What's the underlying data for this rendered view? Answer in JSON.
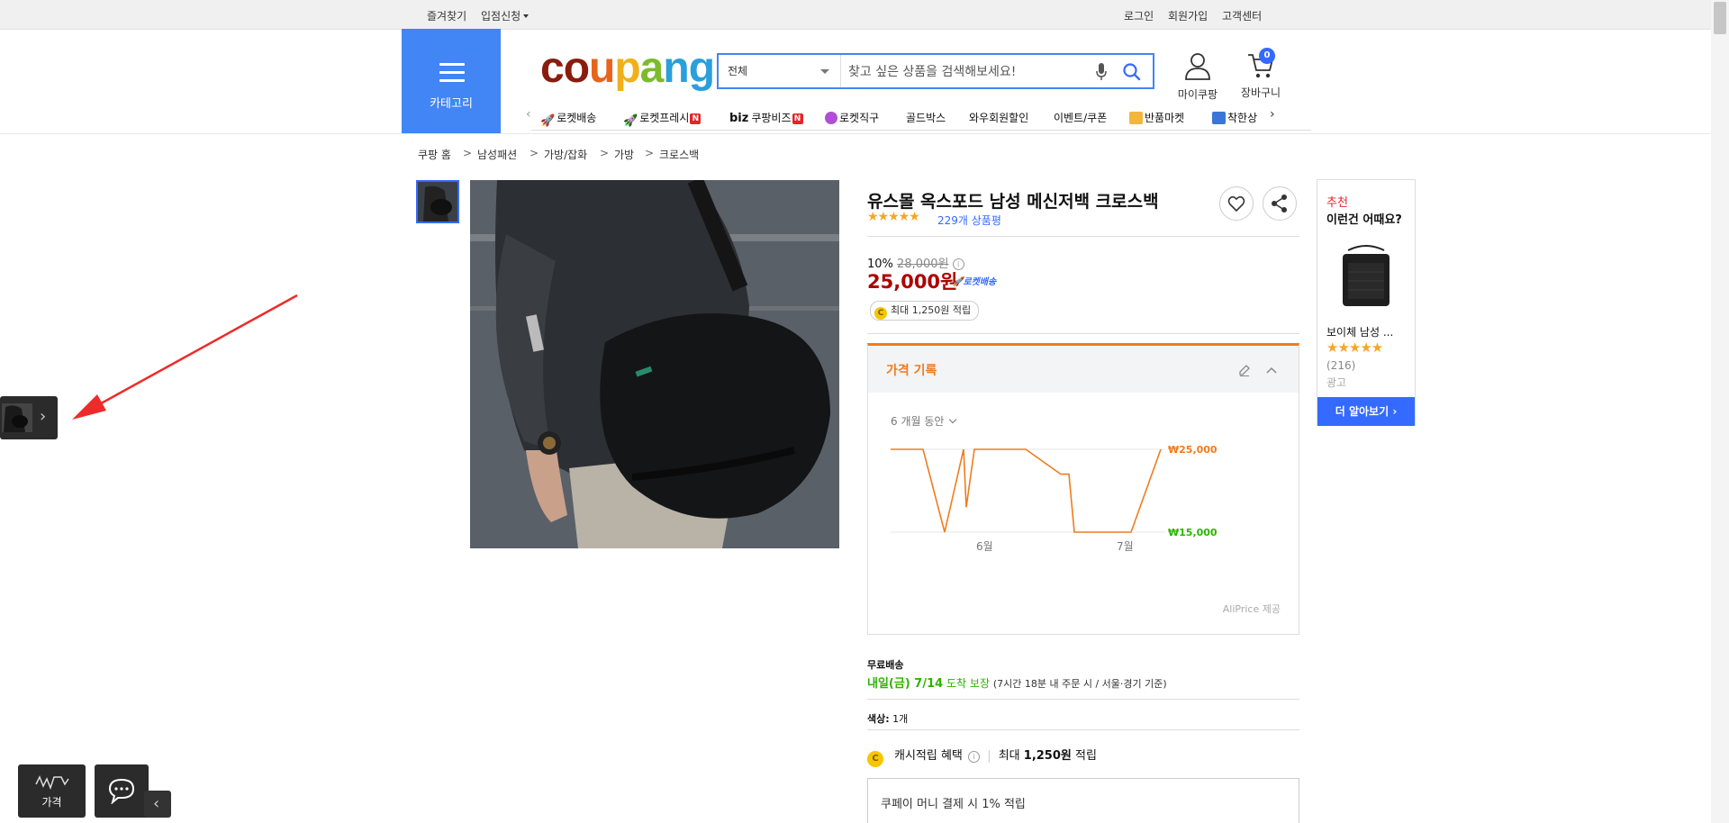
{
  "topbar": {
    "favorites": "즐겨찾기",
    "seller_apply": "입점신청",
    "login": "로그인",
    "signup": "회원가입",
    "customer_center": "고객센터"
  },
  "header": {
    "category_label": "카테고리",
    "logo_parts": [
      "co",
      "u",
      "p",
      "a",
      "ng"
    ],
    "search": {
      "scope": "전체",
      "placeholder": "찾고 싶은 상품을 검색해보세요!"
    },
    "mypage_label": "마이쿠팡",
    "cart_label": "장바구니",
    "cart_count": "0"
  },
  "nav": {
    "items": [
      "로켓배송",
      "로켓프레시",
      "쿠팡비즈",
      "로켓직구",
      "골드박스",
      "와우회원할인",
      "이벤트/쿠폰",
      "반품마켓",
      "착한상"
    ],
    "biz_prefix": "biz",
    "new_badge": "N"
  },
  "breadcrumb": {
    "items": [
      "쿠팡 홈",
      "남성패션",
      "가방/잡화",
      "가방",
      "크로스백"
    ],
    "separator": ">"
  },
  "product": {
    "title": "유스몰 옥스포드 남성 메신저백 크로스백",
    "rating": 4.5,
    "stars": "★★★★★",
    "review_count": "229개 상품평",
    "discount": "10%",
    "original_price": "28,000원",
    "info_glyph": "i",
    "price": "25,000원",
    "rocket": "로켓배송",
    "points_coin": "C",
    "points": "최대 1,250원 적립"
  },
  "price_history": {
    "title": "가격 기록",
    "period": "6 개월 동안",
    "source": "AliPrice 제공",
    "chart_data": {
      "type": "line",
      "y_ticks": [
        "₩25,000",
        "₩15,000"
      ],
      "x_ticks": [
        "6월",
        "7월"
      ],
      "ylim": [
        15000,
        25000
      ],
      "series": [
        {
          "color": "#f07c1e",
          "x": [
            0,
            0.12,
            0.2,
            0.27,
            0.28,
            0.31,
            0.33,
            0.35,
            0.5,
            0.63,
            0.66,
            0.68,
            0.89,
            1.0
          ],
          "values": [
            25000,
            25000,
            15000,
            25000,
            18000,
            25000,
            25000,
            25000,
            25000,
            22000,
            22000,
            15000,
            15000,
            25000
          ]
        }
      ],
      "colors": {
        "max_label": "#f07c1e",
        "min_label": "#2db400"
      }
    }
  },
  "delivery": {
    "free_shipping": "무료배송",
    "arrival": "내일(금) 7/14",
    "guarantee": "도착 보장",
    "condition": "(7시간 18분  내 주문 시 / 서울·경기 기준)",
    "color_label": "색상:",
    "color_value": "1개",
    "cash_benefit": "캐시적립 혜택",
    "cash_max_prefix": "최대",
    "cash_max_amount": "1,250원",
    "cash_max_suffix": "적립",
    "coupay": "쿠페이 머니 결제 시 1% 적립"
  },
  "recommend": {
    "label": "추천",
    "question": "이런건 어때요?",
    "item_name": "보이체 남성 ...",
    "item_stars": "★★★★★",
    "item_reviews": "(216)",
    "ad_label": "광고",
    "more": "더 알아보기"
  },
  "widgets": {
    "price_label": "가격"
  },
  "colors": {
    "brand_blue": "#4285f4",
    "accent_blue": "#346aff",
    "price_red": "#ae0000",
    "orange": "#f07c1e",
    "green": "#2db400"
  }
}
